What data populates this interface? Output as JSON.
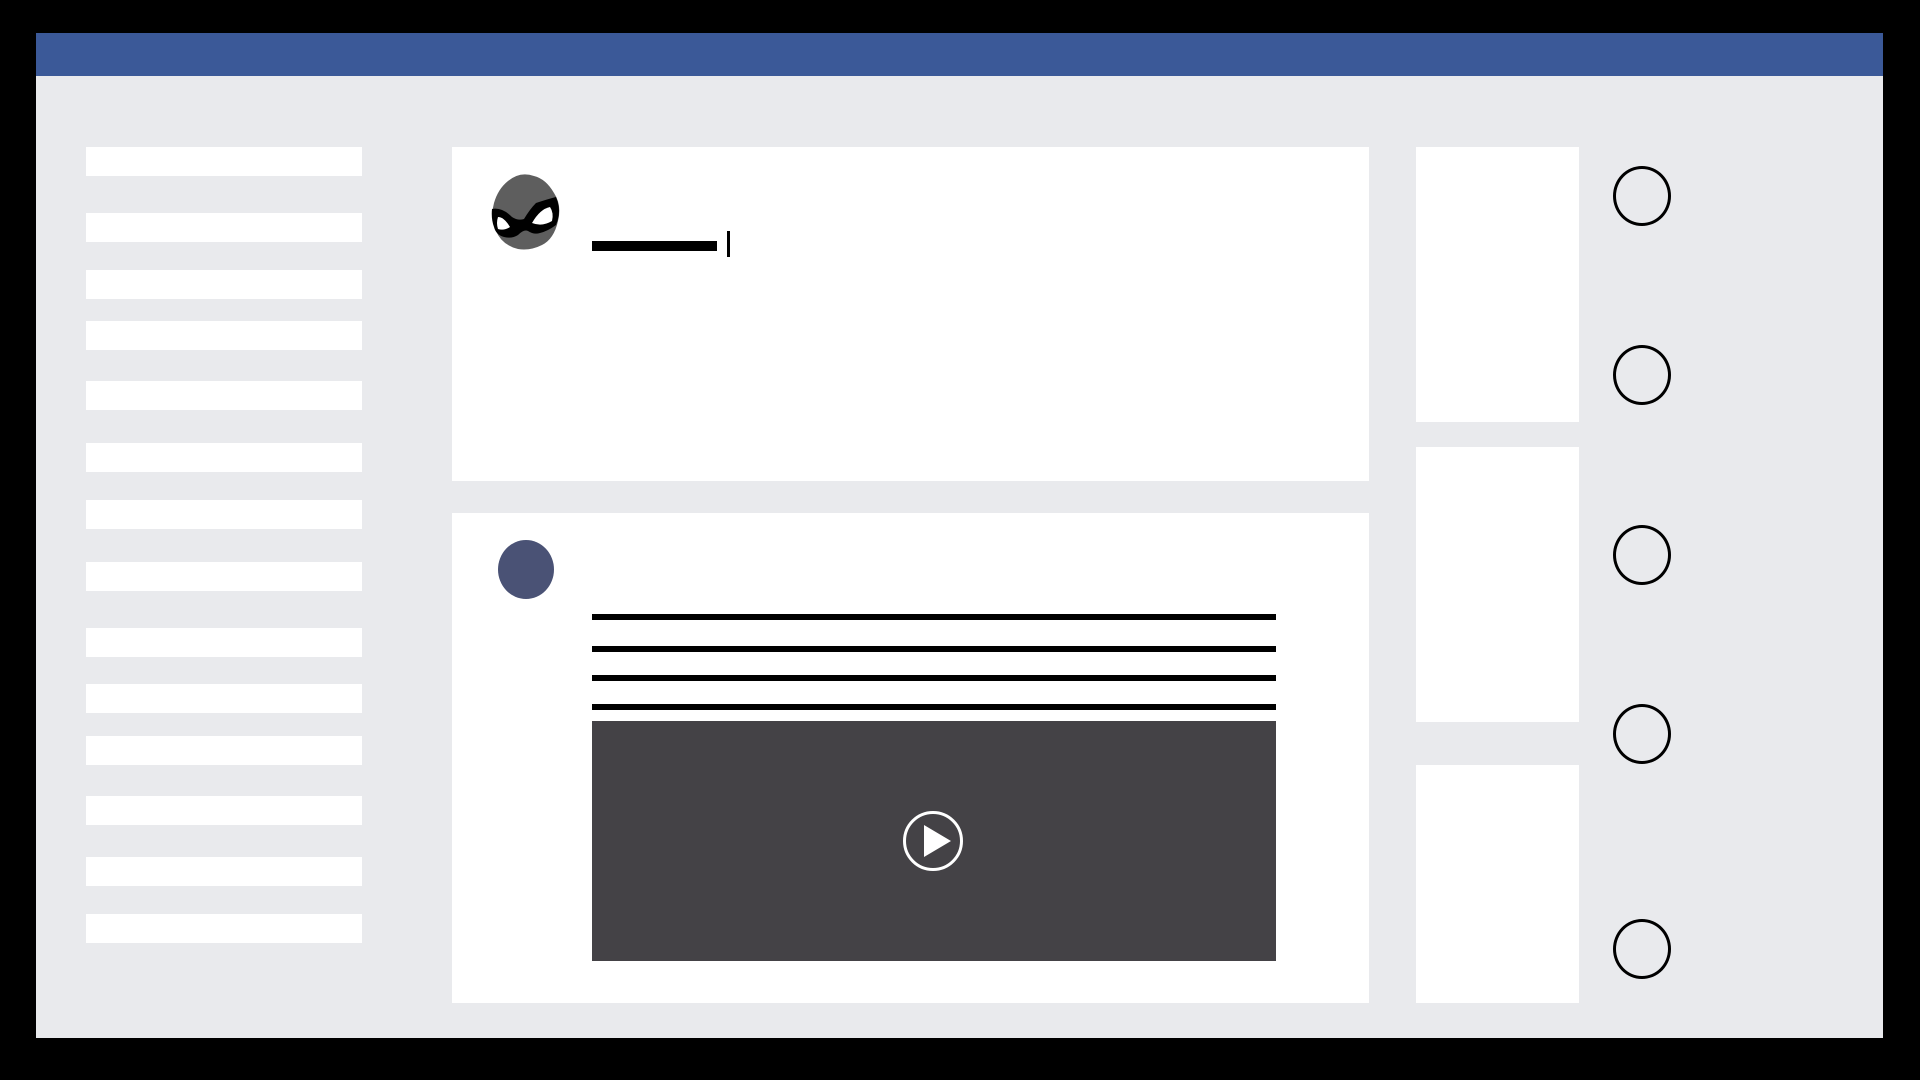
{
  "colors": {
    "frame": "#000000",
    "background": "#e9eaed",
    "topbar": "#3b5998",
    "card": "#ffffff",
    "post_avatar": "#4a5275",
    "video": "#444246",
    "mask_avatar": "#5e5e5e"
  },
  "icons": {
    "composer_avatar": "masked-face-icon",
    "video_control": "play-icon",
    "contacts": "contact-circle-icon"
  },
  "sidebar": {
    "item_count": 14
  },
  "composer": {
    "text": ""
  },
  "post": {
    "text_lines": 4
  },
  "right_column": {
    "cards": 3,
    "contacts": 5
  }
}
